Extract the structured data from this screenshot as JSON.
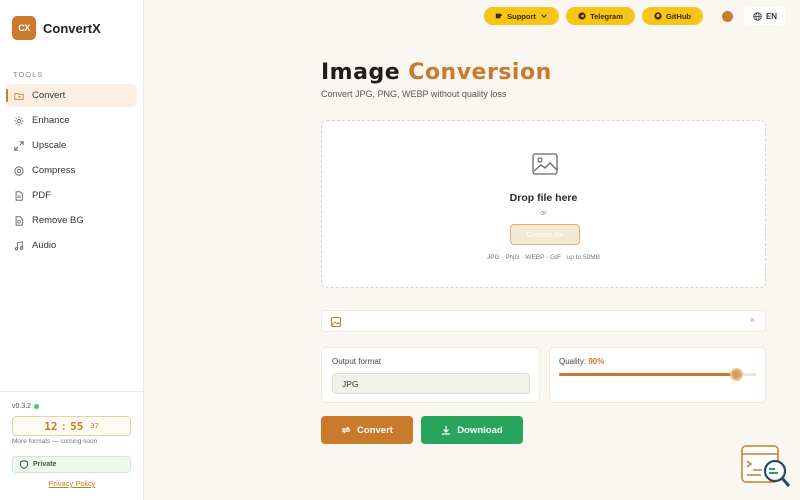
{
  "brand": {
    "logo_text": "CX",
    "name": "ConvertX"
  },
  "sidebar": {
    "section_label": "TOOLS",
    "items": [
      {
        "label": "Convert",
        "icon": "folder-icon",
        "active": true
      },
      {
        "label": "Enhance",
        "icon": "sparkle-icon"
      },
      {
        "label": "Upscale",
        "icon": "expand-icon"
      },
      {
        "label": "Compress",
        "icon": "compress-icon"
      },
      {
        "label": "PDF",
        "icon": "document-icon"
      },
      {
        "label": "Remove BG",
        "icon": "scissors-icon"
      },
      {
        "label": "Audio",
        "icon": "music-icon"
      }
    ],
    "version": "v0.3.2",
    "clock": {
      "hours": "12",
      "minutes": "55",
      "seconds": "37"
    },
    "more_formats": "More formats — coming soon",
    "private_label": "Private",
    "privacy_link": "Privacy Policy"
  },
  "header": {
    "support_label": "Support",
    "telegram_label": "Telegram",
    "github_label": "GitHub",
    "language": "EN",
    "colors": {
      "pill": "#f5c518",
      "accent": "#c97a2b"
    }
  },
  "main": {
    "title_part1": "Image",
    "title_part2": "Conversion",
    "subtitle": "Convert JPG, PNG, WEBP without quality loss",
    "dropzone": {
      "title": "Drop file here",
      "or": "or",
      "button_label": "Choose file",
      "note": "JPG · PNG · WEBP · GIF · up to 50MB"
    },
    "file_bar": {
      "close": "×"
    },
    "output_format": {
      "label": "Output format",
      "value": "JPG"
    },
    "quality": {
      "label": "Quality:",
      "value_text": "90%",
      "value": 90
    },
    "convert_label": "Convert",
    "download_label": "Download",
    "colors": {
      "convert": "#c97a2b",
      "download": "#28a45c"
    }
  }
}
